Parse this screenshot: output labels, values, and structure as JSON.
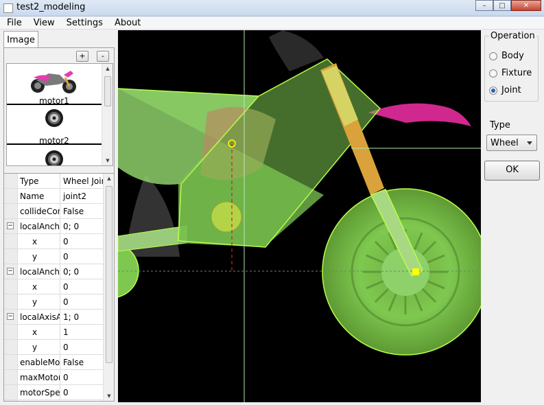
{
  "window": {
    "title": "test2_modeling",
    "minimize": "–",
    "maximize": "□",
    "close": "✕"
  },
  "menu": [
    "File",
    "View",
    "Settings",
    "About"
  ],
  "image_panel": {
    "tab_label": "Image",
    "add_label": "+",
    "remove_label": "-",
    "items": [
      {
        "label": "motor1",
        "icon": "motorbike-thumbnail"
      },
      {
        "label": "motor2",
        "icon": "wheel-thumbnail"
      },
      {
        "label": "",
        "icon": "wheel-thumbnail"
      }
    ]
  },
  "properties": [
    {
      "key": "Type",
      "value": "Wheel Joint",
      "expander": "",
      "child": false
    },
    {
      "key": "Name",
      "value": "joint2",
      "expander": "",
      "child": false
    },
    {
      "key": "collideConnected",
      "value": "False",
      "expander": "",
      "child": false
    },
    {
      "key": "localAnchorA",
      "value": "0; 0",
      "expander": "−",
      "child": false
    },
    {
      "key": "x",
      "value": "0",
      "expander": "",
      "child": true
    },
    {
      "key": "y",
      "value": "0",
      "expander": "",
      "child": true
    },
    {
      "key": "localAnchorB",
      "value": "0; 0",
      "expander": "−",
      "child": false
    },
    {
      "key": "x",
      "value": "0",
      "expander": "",
      "child": true
    },
    {
      "key": "y",
      "value": "0",
      "expander": "",
      "child": true
    },
    {
      "key": "localAxisA",
      "value": "1; 0",
      "expander": "−",
      "child": false
    },
    {
      "key": "x",
      "value": "1",
      "expander": "",
      "child": true
    },
    {
      "key": "y",
      "value": "0",
      "expander": "",
      "child": true
    },
    {
      "key": "enableMotor",
      "value": "False",
      "expander": "",
      "child": false
    },
    {
      "key": "maxMotorTorque",
      "value": "0",
      "expander": "",
      "child": false
    },
    {
      "key": "motorSpeed",
      "value": "0",
      "expander": "",
      "child": false
    }
  ],
  "operation": {
    "title": "Operation",
    "options": [
      {
        "label": "Body",
        "selected": false
      },
      {
        "label": "Fixture",
        "selected": false
      },
      {
        "label": "Joint",
        "selected": true
      }
    ]
  },
  "type_select": {
    "title": "Type",
    "value": "Wheel"
  },
  "ok_label": "OK",
  "colors": {
    "shape_fill": "#7ec850",
    "shape_stroke": "#b8ff4a",
    "anchor": "#ffff00",
    "axis_line": "#cc2222"
  }
}
